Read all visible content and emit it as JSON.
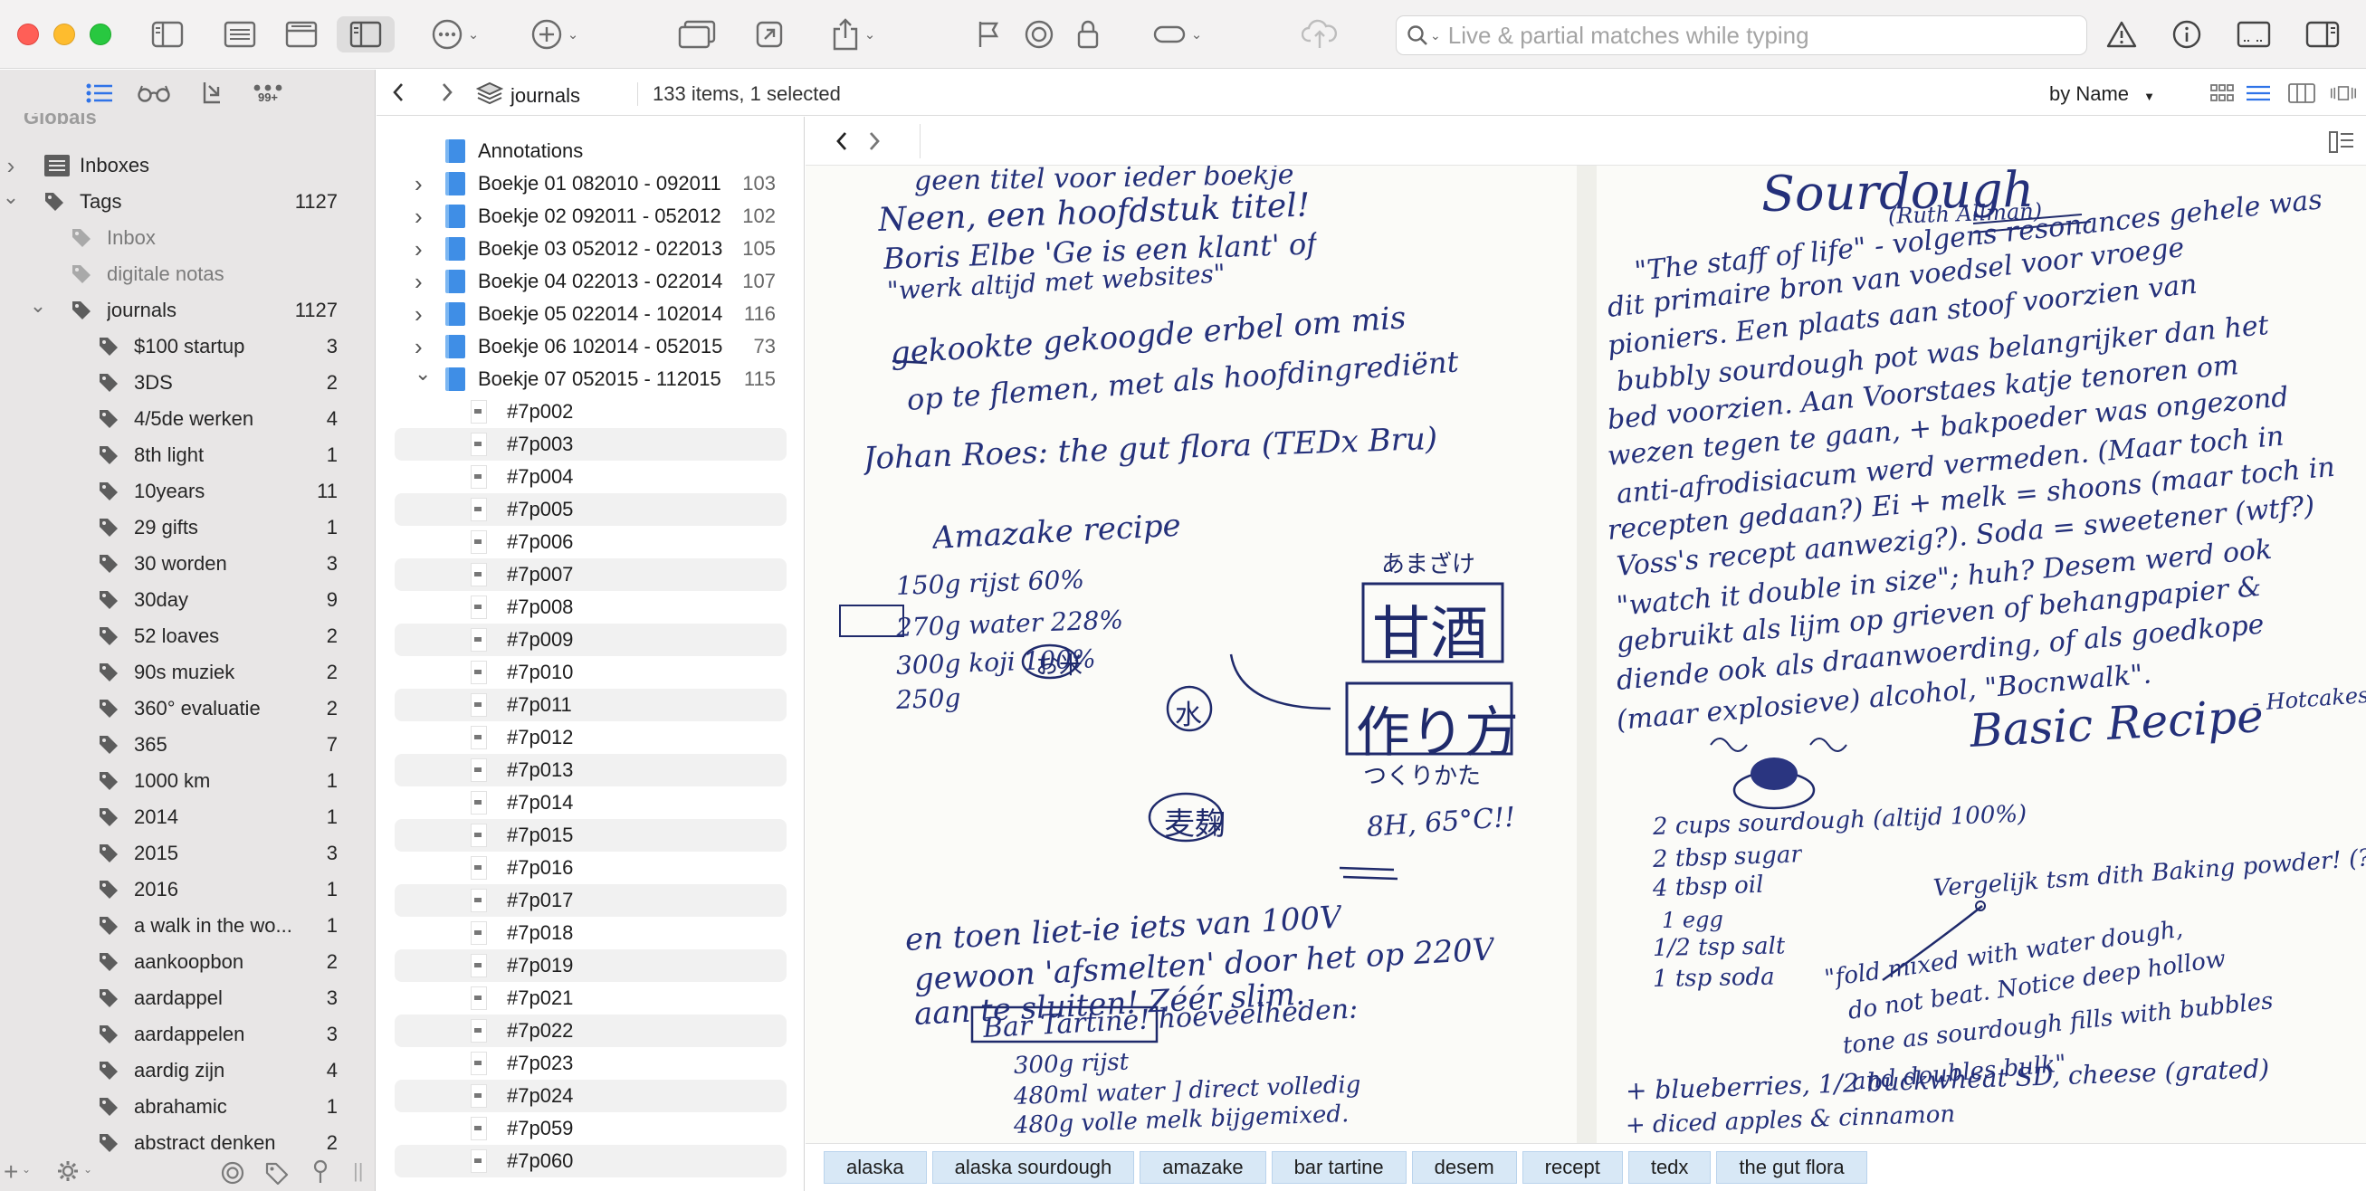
{
  "search": {
    "placeholder": "Live & partial matches while typing"
  },
  "sidebar": {
    "globals_label": "Globals",
    "tabs": [
      {
        "name": "list-icon",
        "active": true
      },
      {
        "name": "glasses-icon",
        "active": false
      },
      {
        "name": "inbox-arrow-icon",
        "active": false
      },
      {
        "name": "more-dots-icon",
        "badge": "99+",
        "active": false
      }
    ],
    "items": [
      {
        "label": "Inboxes",
        "count": "",
        "icon": "inbox-icon",
        "level": 0,
        "disclosure": "collapsed"
      },
      {
        "label": "Tags",
        "count": "1127",
        "icon": "tag-icon",
        "level": 0,
        "disclosure": "expanded"
      },
      {
        "label": "Inbox",
        "count": "",
        "icon": "tag-icon",
        "level": 1,
        "disclosure": "none",
        "dim": true
      },
      {
        "label": "digitale notas",
        "count": "",
        "icon": "tag-icon",
        "level": 1,
        "disclosure": "none",
        "dim": true
      },
      {
        "label": "journals",
        "count": "1127",
        "icon": "tag-icon",
        "level": 1,
        "disclosure": "expanded"
      },
      {
        "label": "$100 startup",
        "count": "3",
        "icon": "tag-icon",
        "level": 2,
        "disclosure": "none"
      },
      {
        "label": "3DS",
        "count": "2",
        "icon": "tag-icon",
        "level": 2,
        "disclosure": "none"
      },
      {
        "label": "4/5de werken",
        "count": "4",
        "icon": "tag-icon",
        "level": 2,
        "disclosure": "none"
      },
      {
        "label": "8th light",
        "count": "1",
        "icon": "tag-icon",
        "level": 2,
        "disclosure": "none"
      },
      {
        "label": "10years",
        "count": "11",
        "icon": "tag-icon",
        "level": 2,
        "disclosure": "none"
      },
      {
        "label": "29 gifts",
        "count": "1",
        "icon": "tag-icon",
        "level": 2,
        "disclosure": "none"
      },
      {
        "label": "30 worden",
        "count": "3",
        "icon": "tag-icon",
        "level": 2,
        "disclosure": "none"
      },
      {
        "label": "30day",
        "count": "9",
        "icon": "tag-icon",
        "level": 2,
        "disclosure": "none"
      },
      {
        "label": "52 loaves",
        "count": "2",
        "icon": "tag-icon",
        "level": 2,
        "disclosure": "none"
      },
      {
        "label": "90s muziek",
        "count": "2",
        "icon": "tag-icon",
        "level": 2,
        "disclosure": "none"
      },
      {
        "label": "360° evaluatie",
        "count": "2",
        "icon": "tag-icon",
        "level": 2,
        "disclosure": "none"
      },
      {
        "label": "365",
        "count": "7",
        "icon": "tag-icon",
        "level": 2,
        "disclosure": "none"
      },
      {
        "label": "1000 km",
        "count": "1",
        "icon": "tag-icon",
        "level": 2,
        "disclosure": "none"
      },
      {
        "label": "2014",
        "count": "1",
        "icon": "tag-icon",
        "level": 2,
        "disclosure": "none"
      },
      {
        "label": "2015",
        "count": "3",
        "icon": "tag-icon",
        "level": 2,
        "disclosure": "none"
      },
      {
        "label": "2016",
        "count": "1",
        "icon": "tag-icon",
        "level": 2,
        "disclosure": "none"
      },
      {
        "label": "a walk in the wo...",
        "count": "1",
        "icon": "tag-icon",
        "level": 2,
        "disclosure": "none"
      },
      {
        "label": "aankoopbon",
        "count": "2",
        "icon": "tag-icon",
        "level": 2,
        "disclosure": "none"
      },
      {
        "label": "aardappel",
        "count": "3",
        "icon": "tag-icon",
        "level": 2,
        "disclosure": "none"
      },
      {
        "label": "aardappelen",
        "count": "3",
        "icon": "tag-icon",
        "level": 2,
        "disclosure": "none"
      },
      {
        "label": "aardig zijn",
        "count": "4",
        "icon": "tag-icon",
        "level": 2,
        "disclosure": "none"
      },
      {
        "label": "abrahamic",
        "count": "1",
        "icon": "tag-icon",
        "level": 2,
        "disclosure": "none"
      },
      {
        "label": "abstract denken",
        "count": "2",
        "icon": "tag-icon",
        "level": 2,
        "disclosure": "none"
      }
    ]
  },
  "pathbar": {
    "crumb": "journals",
    "count_text": "133 items, 1 selected",
    "sort_label": "by Name"
  },
  "itemlist": {
    "groups": [
      {
        "name": "Annotations",
        "count": "",
        "disclosure": "none"
      },
      {
        "name": "Boekje 01 082010 - 092011",
        "count": "103",
        "disclosure": "collapsed"
      },
      {
        "name": "Boekje 02 092011 - 052012",
        "count": "102",
        "disclosure": "collapsed"
      },
      {
        "name": "Boekje 03 052012 - 022013",
        "count": "105",
        "disclosure": "collapsed"
      },
      {
        "name": "Boekje 04 022013 - 022014",
        "count": "107",
        "disclosure": "collapsed"
      },
      {
        "name": "Boekje 05 022014 - 102014",
        "count": "116",
        "disclosure": "collapsed"
      },
      {
        "name": "Boekje 06 102014 - 052015",
        "count": "73",
        "disclosure": "collapsed"
      },
      {
        "name": "Boekje 07 052015 - 112015",
        "count": "115",
        "disclosure": "expanded"
      }
    ],
    "pages": [
      "#7p002",
      "#7p003",
      "#7p004",
      "#7p005",
      "#7p006",
      "#7p007",
      "#7p008",
      "#7p009",
      "#7p010",
      "#7p011",
      "#7p012",
      "#7p013",
      "#7p014",
      "#7p015",
      "#7p016",
      "#7p017",
      "#7p018",
      "#7p019",
      "#7p021",
      "#7p022",
      "#7p023",
      "#7p024",
      "#7p059",
      "#7p060"
    ]
  },
  "document": {
    "left_page": [
      "geen titel voor ieder boekje",
      "Neen, een hoofdstuk titel!",
      "Boris Elbe 'Ge is een klant' of",
      "\"werk altijd met websites\"",
      "gekookte gekoogde erbel om mis",
      "op te flemen, met als hoofdingrediënt",
      "Johan Roes: the gut flora (TEDx Bru)",
      "Amazake recipe",
      "150g rijst   60%",
      "270g water   228%",
      "300g koji   100%",
      "250g",
      "8H, 65°C!!",
      "en toen liet-ie iets van 100V",
      "gewoon 'afsmelten' door het op 220V",
      "aan te sluiten! Zéér slim.",
      "Bar Tartine! hoeveelheden:",
      "300g rijst",
      "480ml water ] direct volledig",
      "480g volle melk bijgemixed."
    ],
    "left_kanji": {
      "box1": "甘酒",
      "box1_reading": "あまざけ",
      "box2": "作り方",
      "box2_reading": "つくりかた",
      "circle1": "水",
      "circle2": "麦麹",
      "circle3": "お米"
    },
    "right_page": [
      "Sourdough",
      "(Ruth Allman)",
      "\"The staff of life\" - volgens resonances gehele was",
      "dit primaire bron van voedsel voor vroege",
      "pioniers. Een plaats aan stoof voorzien van",
      "bubbly sourdough pot was belangrijker dan het",
      "bed voorzien. Aan Voorstaes katje tenoren om",
      "wezen tegen te gaan, + bakpoeder was ongezond",
      "anti-afrodisiacum werd vermeden. (Maar toch in",
      "recepten gedaan?) Ei + melk = shoons (maar toch in",
      "Voss's recept aanwezig?). Soda = sweetener (wtf?)",
      "\"watch it double in size\"; huh? Desem werd ook",
      "gebruikt als lijm op grieven of behangpapier &",
      "diende ook als draanwoerding, of als goedkope",
      "(maar explosieve) alcohol, \"Bocnwalk\".",
      "Basic Recipe",
      "- Hotcakes -",
      "2 cups sourdough (altijd 100%)",
      "2 tbsp sugar",
      "4 tbsp oil",
      "1 egg",
      "1/2 tsp salt",
      "1 tsp soda",
      "Vergelijk tsm dith Baking powder! (?)",
      "\"fold mixed with water dough,",
      "do not beat. Notice deep hollow",
      "tone as sourdough fills with bubbles",
      "and doubles bulk\"",
      "+ blueberries, 1/2 buckwheat SD, cheese (grated)",
      "+ diced apples & cinnamon"
    ]
  },
  "tags": [
    "alaska",
    "alaska sourdough",
    "amazake",
    "bar tartine",
    "desem",
    "recept",
    "tedx",
    "the gut flora"
  ]
}
